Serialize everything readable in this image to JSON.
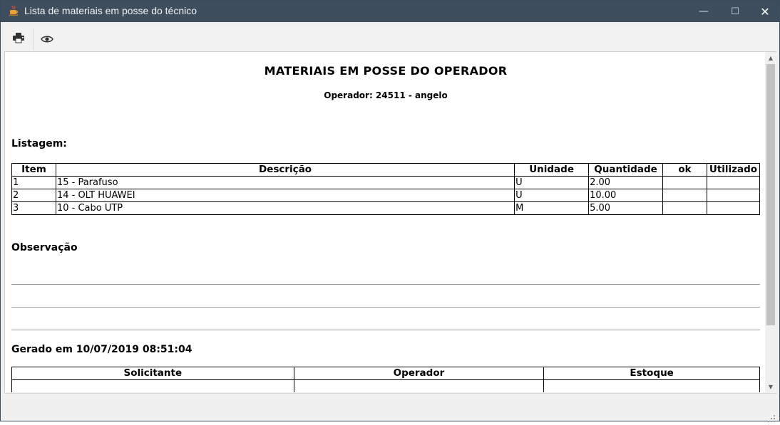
{
  "window": {
    "title": "Lista de materiais em posse do técnico",
    "app_icon": "java-cup-icon",
    "controls": {
      "minimize": "—",
      "maximize": "☐",
      "close": "✕"
    }
  },
  "toolbar": {
    "buttons": [
      {
        "name": "print-button",
        "icon": "printer-icon"
      },
      {
        "name": "preview-button",
        "icon": "eye-icon"
      }
    ]
  },
  "report": {
    "title": "MATERIAIS EM POSSE DO OPERADOR",
    "operator_line": "Operador: 24511 - angelo",
    "listing_heading": "Listagem:",
    "table": {
      "columns": [
        "Item",
        "Descrição",
        "Unidade",
        "Quantidade",
        "ok",
        "Utilizado"
      ],
      "rows": [
        {
          "item": "1",
          "descricao": "15 - Parafuso",
          "unidade": "U",
          "quantidade": "2.00",
          "ok": "",
          "utilizado": ""
        },
        {
          "item": "2",
          "descricao": "14 - OLT HUAWEI",
          "unidade": "U",
          "quantidade": "10.00",
          "ok": "",
          "utilizado": ""
        },
        {
          "item": "3",
          "descricao": "10 - Cabo UTP",
          "unidade": "M",
          "quantidade": "5.00",
          "ok": "",
          "utilizado": ""
        }
      ]
    },
    "observation_heading": "Observação",
    "generated_at": "Gerado em 10/07/2019 08:51:04",
    "signatures": {
      "columns": [
        "Solicitante",
        "Operador",
        "Estoque"
      ]
    }
  },
  "colors": {
    "titlebar": "#3e4e5e",
    "window_bg": "#f0f0f0",
    "page_bg": "#ffffff",
    "scroll_thumb": "#c1c1c1"
  }
}
